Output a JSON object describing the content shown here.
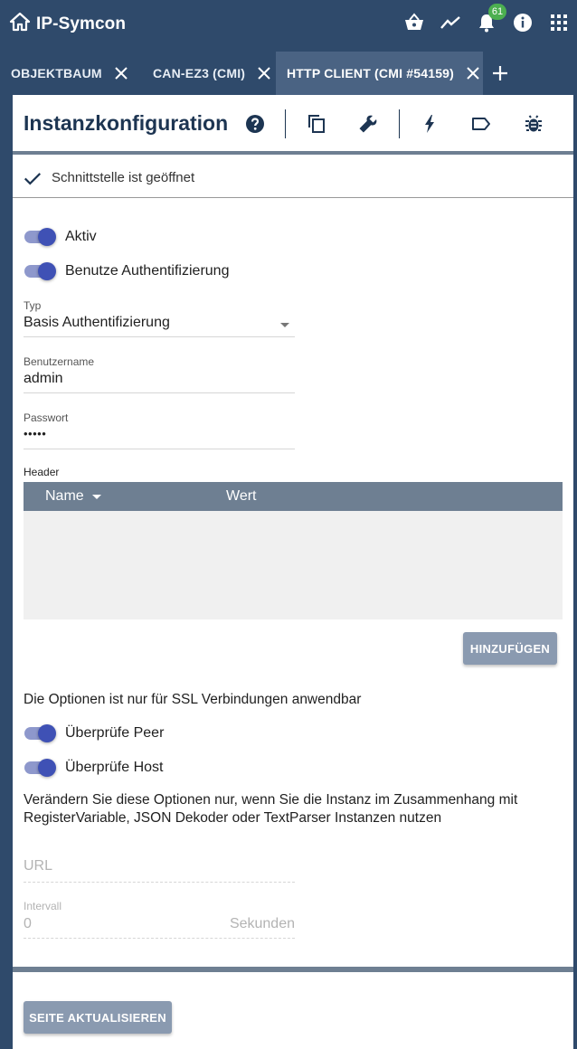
{
  "app": {
    "title": "IP-Symcon",
    "notification_count": "61"
  },
  "topbar_icons": [
    "home-icon",
    "basket-icon",
    "trend-icon",
    "bell-icon",
    "info-icon",
    "apps-grid-icon"
  ],
  "tabs": [
    {
      "label": "OBJEKTBAUM"
    },
    {
      "label": "CAN-EZ3 (CMI)"
    },
    {
      "label": "HTTP CLIENT (CMI #54159)"
    }
  ],
  "header": {
    "title": "Instanzkonfiguration",
    "icons": [
      "help-icon",
      "copy-icon",
      "wrench-icon",
      "bolt-icon",
      "label-icon",
      "bug-icon"
    ]
  },
  "status": {
    "text": "Schnittstelle ist geöffnet"
  },
  "form": {
    "aktiv_label": "Aktiv",
    "auth_label": "Benutze Authentifizierung",
    "typ_label": "Typ",
    "typ_value": "Basis Authentifizierung",
    "user_label": "Benutzername",
    "user_value": "admin",
    "password_label": "Passwort",
    "password_value": "•••••",
    "header_label": "Header",
    "table_columns": [
      "Name",
      "Wert"
    ],
    "add_button": "HINZUFÜGEN",
    "ssl_note": "Die Optionen ist nur für SSL Verbindungen anwendbar",
    "peer_label": "Überprüfe Peer",
    "host_label": "Überprüfe Host",
    "change_note": "Verändern Sie diese Optionen nur, wenn Sie die Instanz im Zusammenhang mit RegisterVariable, JSON Dekoder oder TextParser Instanzen nutzen",
    "url_placeholder": "URL",
    "interval_label": "Intervall",
    "interval_value": "0",
    "interval_suffix": "Sekunden"
  },
  "footer": {
    "refresh_button": "SEITE AKTUALISIEREN"
  },
  "colors": {
    "topbar": "#2f4a6b",
    "accent": "#3f51b5",
    "table_header": "#6e7f92",
    "button": "#8a9ab0",
    "badge": "#4caf50"
  }
}
